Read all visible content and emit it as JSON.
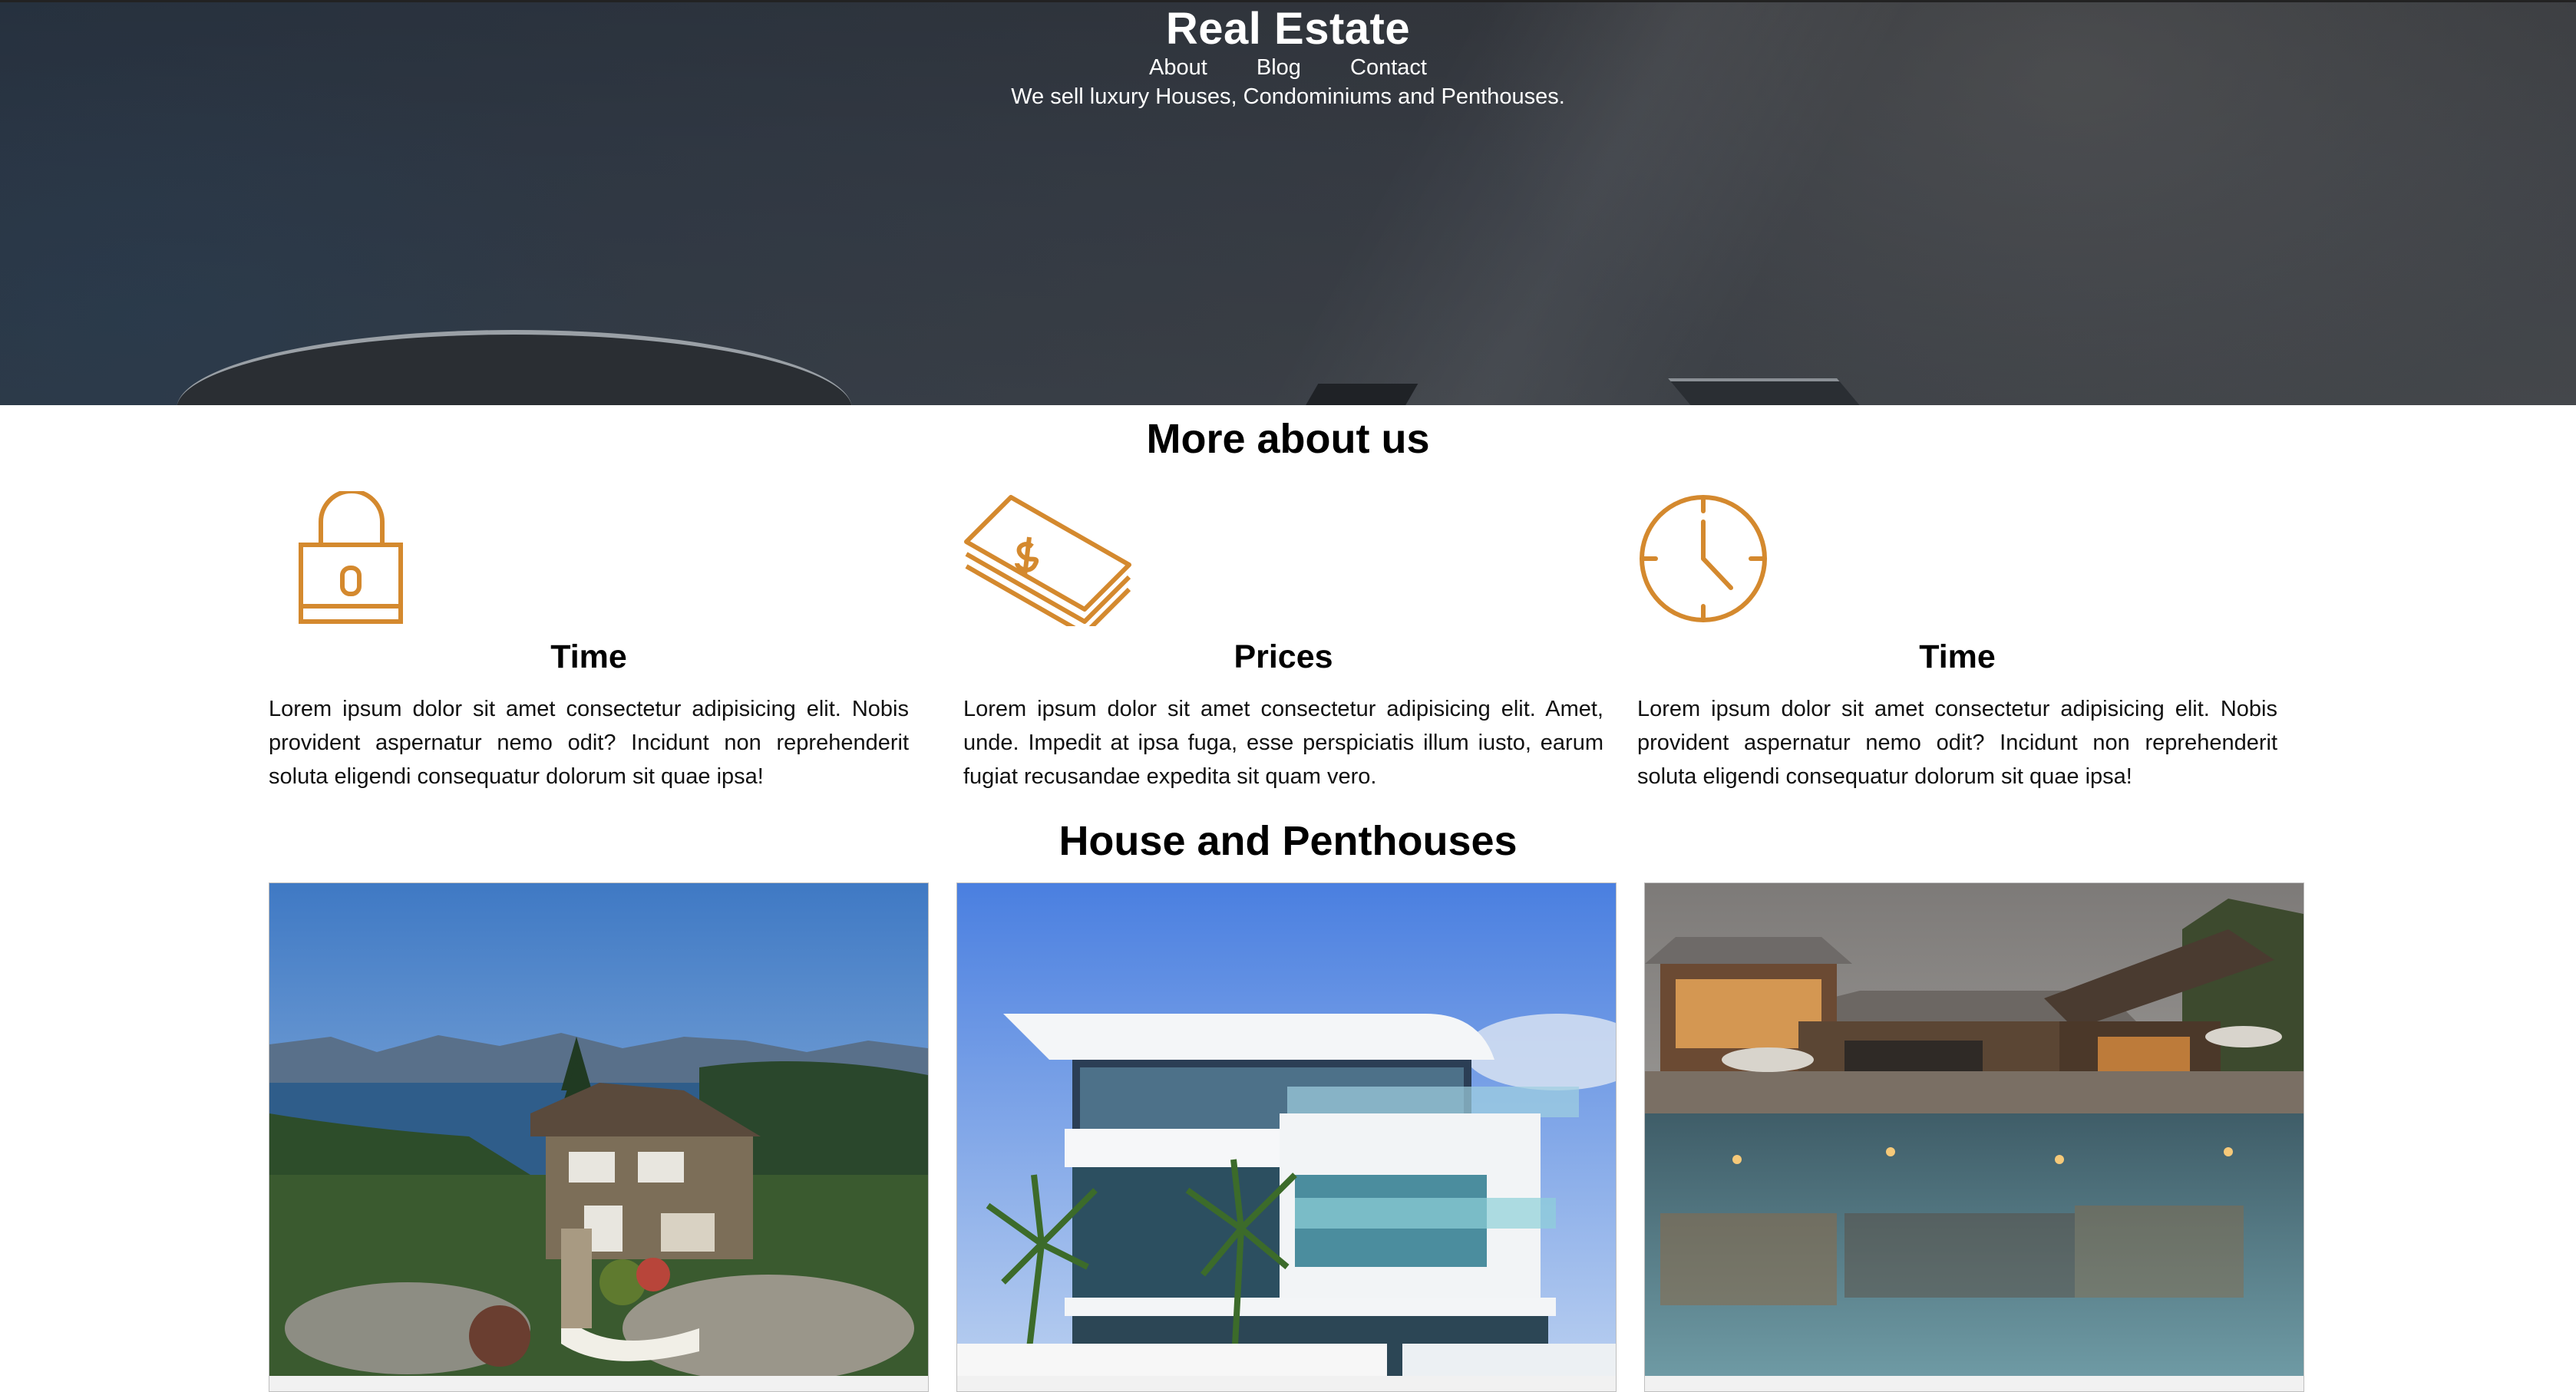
{
  "header": {
    "title": "Real Estate",
    "nav": [
      {
        "label": "About"
      },
      {
        "label": "Blog"
      },
      {
        "label": "Contact"
      }
    ],
    "tagline": "We sell luxury Houses, Condominiums and Penthouses."
  },
  "about": {
    "title": "More about us",
    "features": [
      {
        "icon": "padlock-icon",
        "title": "Time",
        "text": "Lorem ipsum dolor sit amet consectetur adipisicing elit. Nobis provident aspernatur nemo odit? Incidunt non reprehenderit soluta eligendi consequatur dolorum sit quae ipsa!"
      },
      {
        "icon": "money-stack-icon",
        "title": "Prices",
        "text": "Lorem ipsum dolor sit amet consectetur adipisicing elit. Amet, unde. Impedit at ipsa fuga, esse perspiciatis illum iusto, earum fugiat recusandae expedita sit quam vero."
      },
      {
        "icon": "clock-icon",
        "title": "Time",
        "text": "Lorem ipsum dolor sit amet consectetur adipisicing elit. Nobis provident aspernatur nemo odit? Incidunt non reprehenderit soluta eligendi consequatur dolorum sit quae ipsa!"
      }
    ]
  },
  "houses": {
    "title": "House and Penthouses",
    "cards": [
      {
        "image": "lakeside-house-photo"
      },
      {
        "image": "modern-penthouse-photo"
      },
      {
        "image": "pool-lodge-photo"
      }
    ]
  },
  "colors": {
    "accent": "#d4892e",
    "hero_overlay": "#3a3f46"
  }
}
